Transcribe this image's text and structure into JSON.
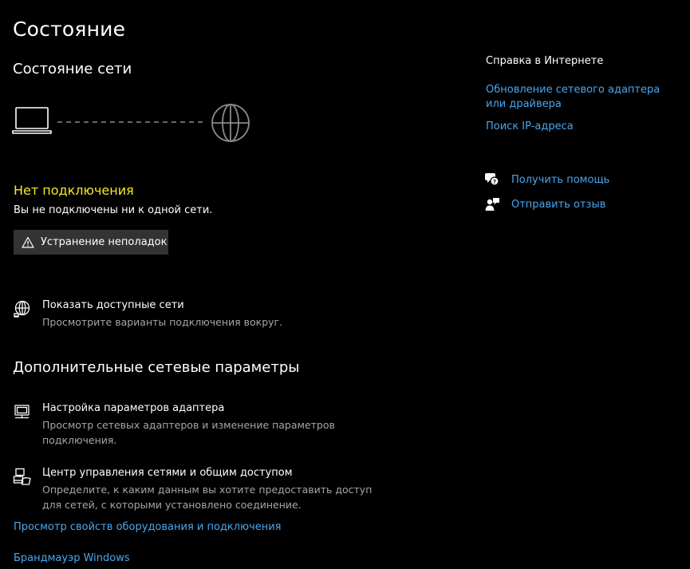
{
  "page": {
    "title": "Состояние"
  },
  "network_status": {
    "section_title": "Состояние сети",
    "headline": "Нет подключения",
    "description": "Вы не подключены ни к одной сети.",
    "troubleshoot_label": "Устранение неполадок",
    "accent_color": "#f4ea2a"
  },
  "available_networks": {
    "title": "Показать доступные сети",
    "description": "Просмотрите варианты подключения вокруг."
  },
  "advanced": {
    "section_title": "Дополнительные сетевые параметры",
    "items": [
      {
        "title": "Настройка параметров адаптера",
        "description": "Просмотр сетевых адаптеров и изменение параметров подключения.",
        "icon": "adapter-icon"
      },
      {
        "title": "Центр управления сетями и общим доступом",
        "description": "Определите, к каким данным вы хотите предоставить доступ для сетей, с которыми установлено соединение.",
        "icon": "sharing-center-icon"
      }
    ],
    "links": [
      "Просмотр свойств оборудования и подключения",
      "Брандмауэр Windows"
    ]
  },
  "aside": {
    "title": "Справка в Интернете",
    "links": [
      "Обновление сетевого адаптера или драйвера",
      "Поиск IP-адреса"
    ],
    "actions": [
      {
        "label": "Получить помощь",
        "icon": "get-help-icon"
      },
      {
        "label": "Отправить отзыв",
        "icon": "feedback-icon"
      }
    ]
  },
  "colors": {
    "background": "#000000",
    "link": "#4aa6ee",
    "muted_text": "#a6a6a6",
    "button_bg": "#333333"
  }
}
